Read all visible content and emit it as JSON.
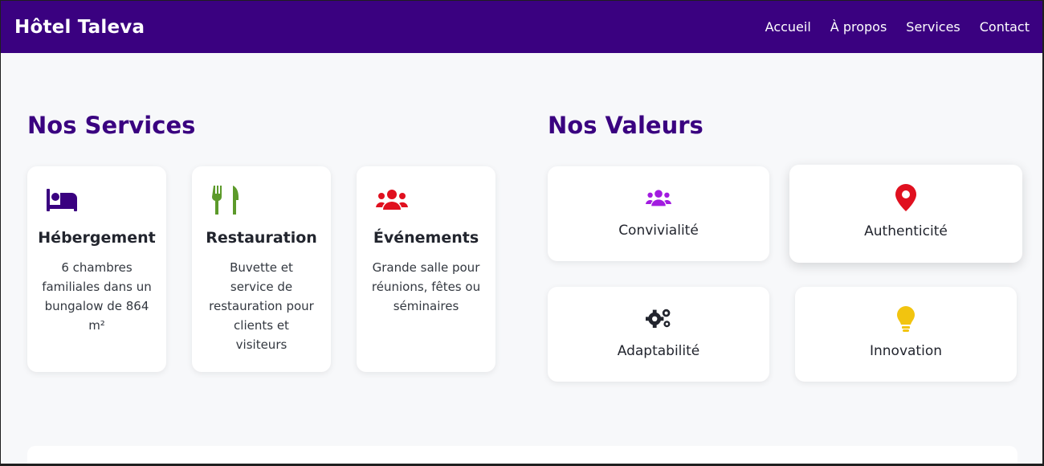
{
  "header": {
    "brand": "Hôtel Taleva",
    "nav": [
      {
        "label": "Accueil"
      },
      {
        "label": "À propos"
      },
      {
        "label": "Services"
      },
      {
        "label": "Contact"
      }
    ]
  },
  "services": {
    "title": "Nos Services",
    "items": [
      {
        "icon": "bed-icon",
        "color": "#3a0180",
        "title": "Hébergement",
        "desc": "6 chambres familiales dans un bungalow de 864 m²"
      },
      {
        "icon": "utensils-icon",
        "color": "#5c9a2a",
        "title": "Restauration",
        "desc": "Buvette et service de restauration pour clients et visiteurs"
      },
      {
        "icon": "users-icon",
        "color": "#e0101f",
        "title": "Événements",
        "desc": "Grande salle pour réunions, fêtes ou séminaires"
      }
    ]
  },
  "values": {
    "title": "Nos Valeurs",
    "items": [
      {
        "icon": "users-icon",
        "color": "#a21be0",
        "label": "Convivialité"
      },
      {
        "icon": "map-pin-icon",
        "color": "#e0101f",
        "label": "Authenticité"
      },
      {
        "icon": "gears-icon",
        "color": "#22252e",
        "label": "Adaptabilité"
      },
      {
        "icon": "lightbulb-icon",
        "color": "#f2c40f",
        "label": "Innovation"
      }
    ]
  },
  "colors": {
    "primary": "#3a0180",
    "background": "#f7f8fa"
  }
}
